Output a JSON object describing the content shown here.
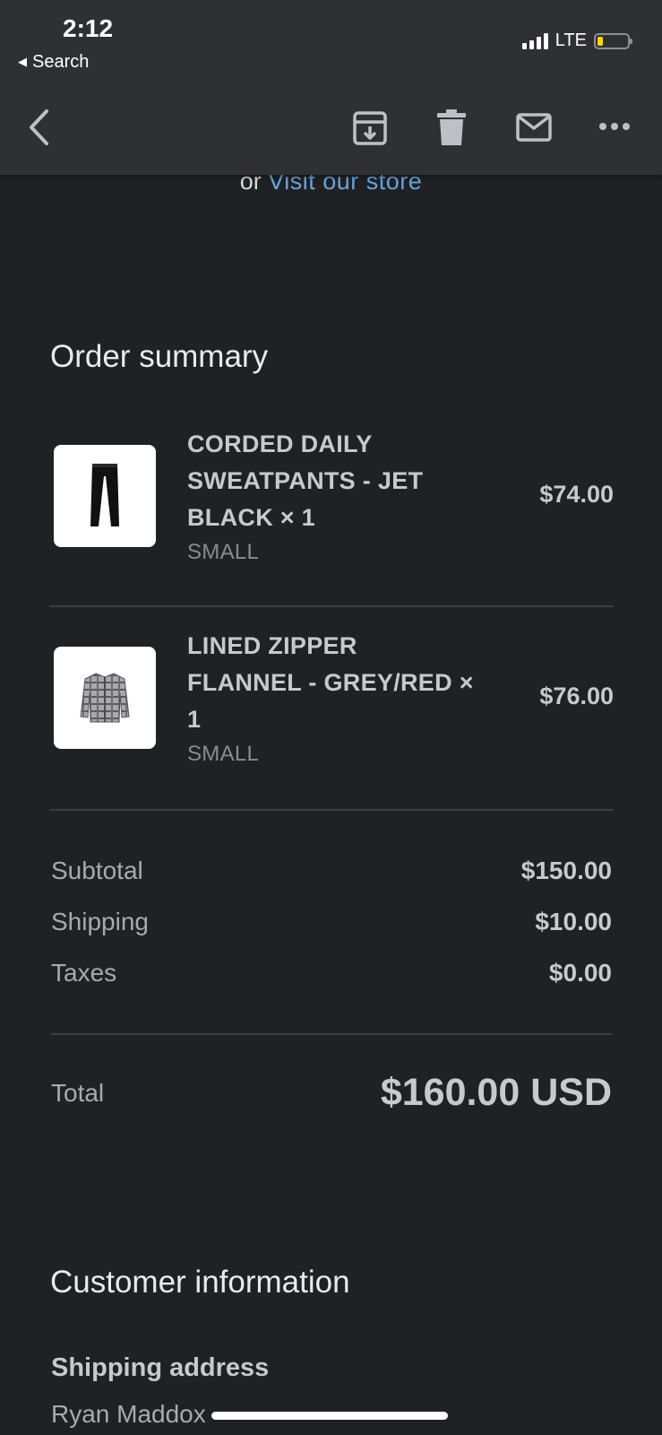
{
  "status_bar": {
    "time": "2:12",
    "back_label": "Search",
    "network": "LTE",
    "battery_level": 0.2,
    "battery_color": "#ffd60a"
  },
  "toolbar": {
    "icons": [
      "back-chevron-icon",
      "archive-icon",
      "delete-icon",
      "mail-icon",
      "more-icon"
    ]
  },
  "store_link": {
    "prefix": "or",
    "link_text": "Visit our store",
    "link_color": "#6aa5d9"
  },
  "order_summary": {
    "title": "Order summary",
    "items": [
      {
        "title": "CORDED DAILY SWEATPANTS - JET BLACK × 1",
        "variant": "SMALL",
        "price": "$74.00",
        "thumbnail": "sweatpants-image"
      },
      {
        "title": "LINED ZIPPER FLANNEL - GREY/RED × 1",
        "variant": "SMALL",
        "price": "$76.00",
        "thumbnail": "flannel-image"
      }
    ],
    "costs": [
      {
        "label": "Subtotal",
        "value": "$150.00"
      },
      {
        "label": "Shipping",
        "value": "$10.00"
      },
      {
        "label": "Taxes",
        "value": "$0.00"
      }
    ],
    "total_label": "Total",
    "total_value": "$160.00 USD"
  },
  "customer_information": {
    "title": "Customer information",
    "shipping_address_label": "Shipping address",
    "name": "Ryan Maddox"
  }
}
